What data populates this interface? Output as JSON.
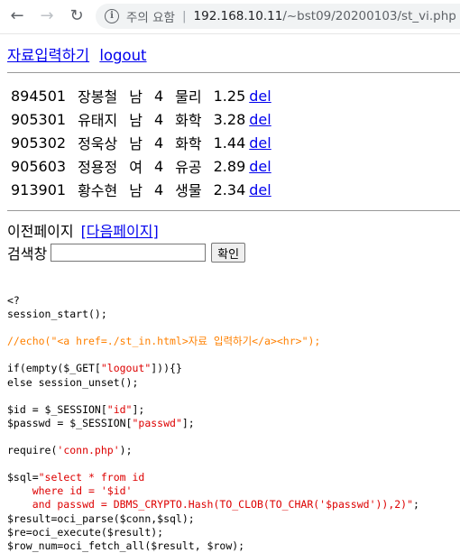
{
  "browser": {
    "security_warning": "주의 요함",
    "url_host": "192.168.10.11",
    "url_path": "/~bst09/20200103/st_vi.php"
  },
  "links": {
    "input": "자료입력하기",
    "logout": "logout"
  },
  "rows": [
    {
      "id": "894501",
      "name": "장봉철",
      "gender": "남",
      "grade": "4",
      "major": "물리",
      "avg": "1.25",
      "del": "del"
    },
    {
      "id": "905301",
      "name": "유태지",
      "gender": "남",
      "grade": "4",
      "major": "화학",
      "avg": "3.28",
      "del": "del"
    },
    {
      "id": "905302",
      "name": "정욱상",
      "gender": "남",
      "grade": "4",
      "major": "화학",
      "avg": "1.44",
      "del": "del"
    },
    {
      "id": "905603",
      "name": "정용정",
      "gender": "여",
      "grade": "4",
      "major": "유공",
      "avg": "2.89",
      "del": "del"
    },
    {
      "id": "913901",
      "name": "황수현",
      "gender": "남",
      "grade": "4",
      "major": "생물",
      "avg": "2.34",
      "del": "del"
    }
  ],
  "pager": {
    "prev": "이전페이지",
    "next": "[다음페이지]"
  },
  "search": {
    "label": "검색창",
    "value": "",
    "button": "확인"
  },
  "source": {
    "l01": "<?",
    "l02": "session_start();",
    "l04": "//echo(\"<a href=./st_in.html>자료 입력하기</a><hr>\");",
    "l06a": "if(empty($_GET[",
    "l06b": "\"logout\"",
    "l06c": "])){}",
    "l07": "else session_unset();",
    "l09a": "$id = $_SESSION[",
    "l09b": "\"id\"",
    "l09c": "];",
    "l10a": "$passwd = $_SESSION[",
    "l10b": "\"passwd\"",
    "l10c": "];",
    "l12a": "require(",
    "l12b": "'conn.php'",
    "l12c": ");",
    "l14a": "$sql=",
    "l14b": "\"select * from id",
    "l15": "    where id = '$id'",
    "l16": "    and passwd = DBMS_CRYPTO.Hash(TO_CLOB(TO_CHAR('$passwd')),2)\"",
    "l16c": ";",
    "l17": "$result=oci_parse($conn,$sql);",
    "l18": "$re=oci_execute($result);",
    "l19": "$row_num=oci_fetch_all($result, $row);"
  }
}
